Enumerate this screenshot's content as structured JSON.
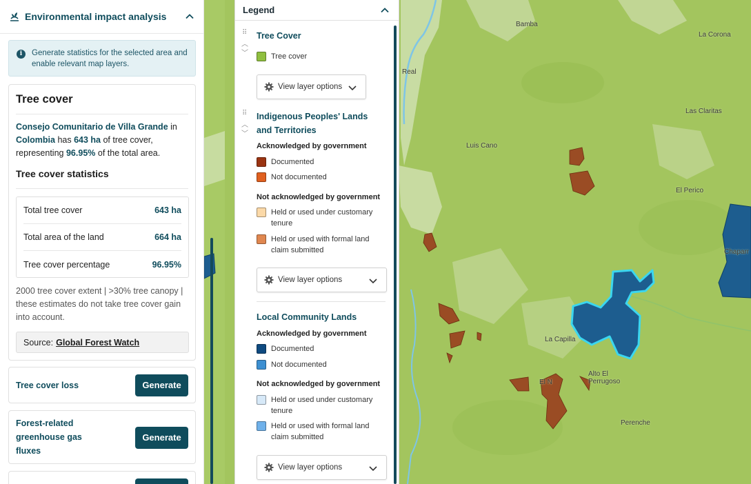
{
  "panel": {
    "title": "Environmental impact analysis",
    "info": "Generate statistics for the selected area and enable relevant map layers."
  },
  "tree_cover": {
    "title": "Tree cover",
    "summary": {
      "area_name": "Consejo Comunitario de Villa Grande",
      "in": "in",
      "country": "Colombia",
      "has": "has",
      "amount": "643 ha",
      "of_tree_cover": "of tree cover,",
      "representing": "representing",
      "percent": "96.95%",
      "of_total": "of the total area."
    },
    "stats_title": "Tree cover statistics",
    "stats": [
      {
        "label": "Total tree cover",
        "value": "643 ha"
      },
      {
        "label": "Total area of the land",
        "value": "664 ha"
      },
      {
        "label": "Tree cover percentage",
        "value": "96.95%"
      }
    ],
    "note": "2000 tree cover extent | >30% tree canopy | these estimates do not take tree cover gain into account.",
    "source_label": "Source:",
    "source_link": "Global Forest Watch"
  },
  "generate_cards": [
    {
      "label": "Tree cover loss",
      "button": "Generate"
    },
    {
      "label": "Forest-related greenhouse gas fluxes",
      "button": "Generate"
    }
  ],
  "legend": {
    "title": "Legend",
    "view_options": "View layer options",
    "tree_cover": {
      "title": "Tree Cover",
      "item": "Tree cover",
      "color": "#8fbf3f"
    },
    "indigenous": {
      "title": "Indigenous Peoples' Lands and Territories",
      "ack_title": "Acknowledged by government",
      "ack": [
        {
          "label": "Documented",
          "color": "#9a3412"
        },
        {
          "label": "Not documented",
          "color": "#e0601f"
        }
      ],
      "notack_title": "Not acknowledged by government",
      "notack": [
        {
          "label": "Held or used under customary tenure",
          "color": "#fbd9a8"
        },
        {
          "label": "Held or used with formal land claim submitted",
          "color": "#e08750"
        }
      ]
    },
    "local": {
      "title": "Local Community Lands",
      "ack_title": "Acknowledged by government",
      "ack": [
        {
          "label": "Documented",
          "color": "#0f4a80"
        },
        {
          "label": "Not documented",
          "color": "#3d8fd1"
        }
      ],
      "notack_title": "Not acknowledged by government",
      "notack": [
        {
          "label": "Held or used under customary tenure",
          "color": "#d7e9f8"
        },
        {
          "label": "Held or used with formal land claim submitted",
          "color": "#6fb1ea"
        }
      ]
    }
  },
  "map": {
    "places": [
      "Bamba",
      "La Corona",
      "Las Claritas",
      "Real",
      "Luis Cano",
      "El Perico",
      "Chaparr",
      "La Capilla",
      "Alto El Perrugoso",
      "El N",
      "Perenche"
    ]
  }
}
